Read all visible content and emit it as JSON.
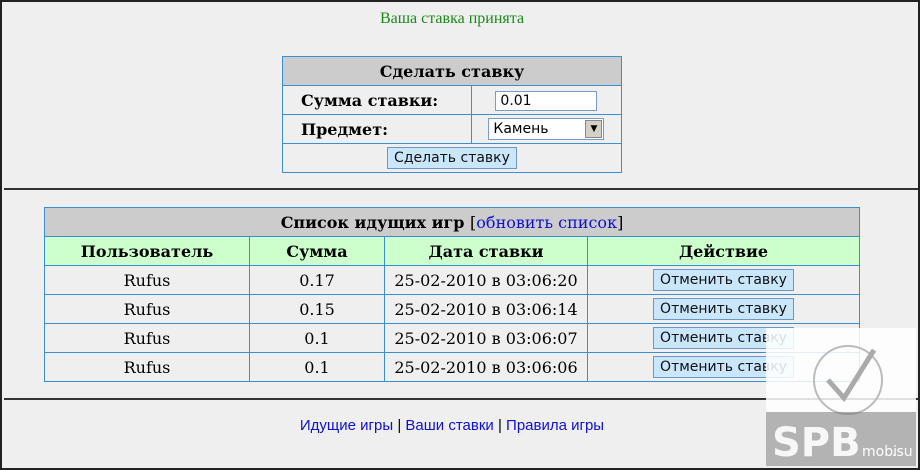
{
  "notice": "Ваша ставка принята",
  "bet_form": {
    "title": "Сделать ставку",
    "amount_label": "Сумма ставки:",
    "amount_value": "0.01",
    "item_label": "Предмет:",
    "item_selected": "Камень",
    "submit_label": "Сделать ставку"
  },
  "games": {
    "title": "Список идущих игр",
    "bracket_open": "[",
    "refresh_link": "обновить список",
    "bracket_close": "]",
    "columns": [
      "Пользователь",
      "Сумма",
      "Дата ставки",
      "Действие"
    ],
    "rows": [
      {
        "user": "Rufus",
        "amount": "0.17",
        "date": "25-02-2010 в 03:06:20",
        "action": "Отменить ставку"
      },
      {
        "user": "Rufus",
        "amount": "0.15",
        "date": "25-02-2010 в 03:06:14",
        "action": "Отменить ставку"
      },
      {
        "user": "Rufus",
        "amount": "0.1",
        "date": "25-02-2010 в 03:06:07",
        "action": "Отменить ставку"
      },
      {
        "user": "Rufus",
        "amount": "0.1",
        "date": "25-02-2010 в 03:06:06",
        "action": "Отменить ставку"
      }
    ]
  },
  "footer": {
    "link1": "Идущие игры",
    "sep": "|",
    "link2": "Ваши ставки",
    "link3": "Правила игры"
  },
  "watermark": {
    "text": "SPB",
    "domain_text": "mobi",
    "tld": ".su"
  },
  "colors": {
    "notice": "#1a8a1a",
    "border": "#3b8fd0",
    "header_green": "#ccffcc",
    "button": "#c9e6fb"
  }
}
